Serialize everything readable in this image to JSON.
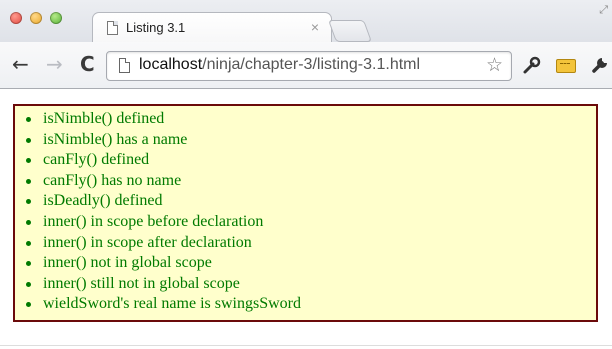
{
  "browser": {
    "tab": {
      "title": "Listing 3.1",
      "close_glyph": "×"
    },
    "nav": {
      "back": "←",
      "forward": "→",
      "reload": "C"
    },
    "address": {
      "host": "localhost",
      "path": "/ninja/chapter-3/listing-3.1.html"
    },
    "icons": {
      "star": "☆",
      "wrench": "🔧",
      "ruler": "ruler-icon",
      "resize": "⤢"
    }
  },
  "results": {
    "items": [
      "isNimble() defined",
      "isNimble() has a name",
      "canFly() defined",
      "canFly() has no name",
      "isDeadly() defined",
      "inner() in scope before declaration",
      "inner() in scope after declaration",
      "inner() not in global scope",
      "inner() still not in global scope",
      "wieldSword's real name is swingsSword"
    ],
    "colors": {
      "background": "#ffffcc",
      "border": "#6b0a0a",
      "text": "#007a00"
    }
  }
}
